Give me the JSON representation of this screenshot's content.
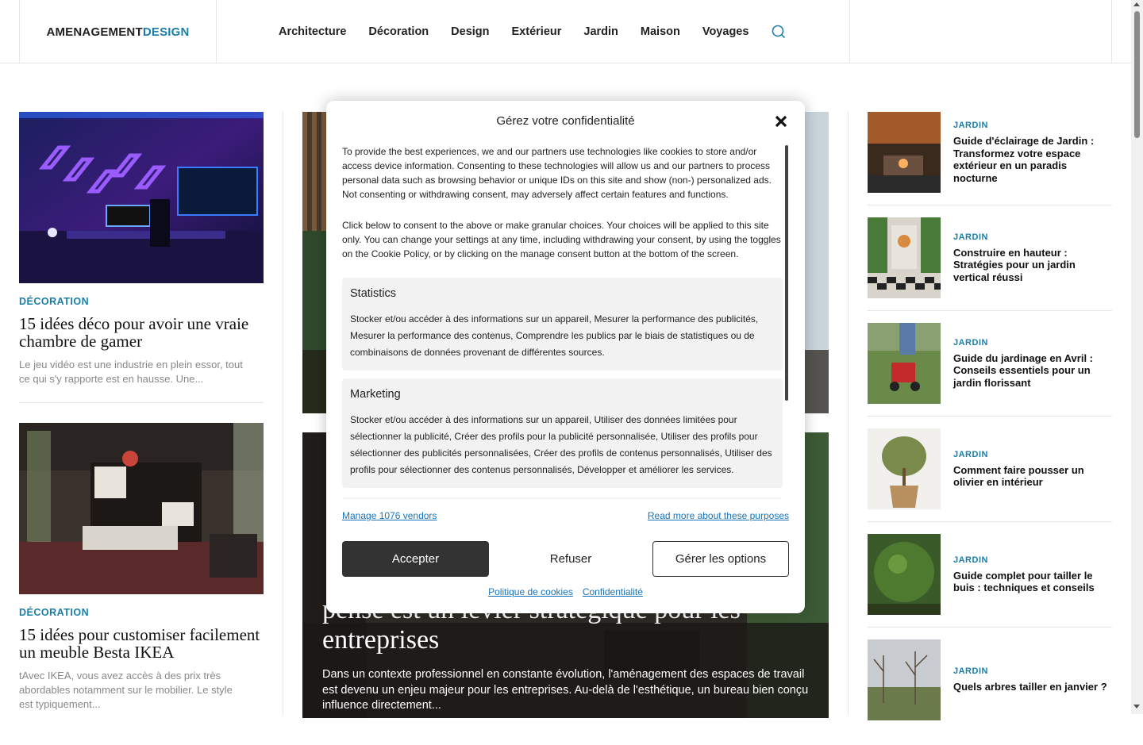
{
  "header": {
    "logo_part1": "AMENAGEMENT",
    "logo_part2": "DESIGN",
    "nav": [
      "Architecture",
      "Décoration",
      "Design",
      "Extérieur",
      "Jardin",
      "Maison",
      "Voyages"
    ]
  },
  "left_cards": [
    {
      "category": "DÉCORATION",
      "title": "15 idées déco pour avoir une vraie chambre de gamer",
      "excerpt": "Le jeu vidéo est une industrie en plein essor, tout ce qui s'y rapporte est en hausse. Une..."
    },
    {
      "category": "DÉCORATION",
      "title": "15 idées pour customiser facilement un meuble Besta IKEA",
      "excerpt": "tAvec IKEA, vous avez accès à des prix très abordables notamment sur le mobilier. Le style est typiquement..."
    }
  ],
  "featured2": {
    "title": "pensé est un levier stratégique pour les entreprises",
    "excerpt": "Dans un contexte professionnel en constante évolution, l'aménagement des espaces de travail est devenu un enjeu majeur pour les entreprises. Au-delà de l'esthétique, un bureau bien conçu influence directement..."
  },
  "right_items": [
    {
      "category": "JARDIN",
      "title": "Guide d'éclairage de Jardin : Transformez votre espace extérieur en un paradis nocturne"
    },
    {
      "category": "JARDIN",
      "title": "Construire en hauteur : Stratégies pour un jardin vertical réussi"
    },
    {
      "category": "JARDIN",
      "title": "Guide du jardinage en Avril : Conseils essentiels pour un jardin florissant"
    },
    {
      "category": "JARDIN",
      "title": "Comment faire pousser un olivier en intérieur"
    },
    {
      "category": "JARDIN",
      "title": "Guide complet pour tailler le buis : techniques et conseils"
    },
    {
      "category": "JARDIN",
      "title": "Quels arbres tailler en janvier ?"
    }
  ],
  "consent": {
    "title": "Gérez votre confidentialité",
    "para1": "To provide the best experiences, we and our partners use technologies like cookies to store and/or access device information. Consenting to these technologies will allow us and our partners to process personal data such as browsing behavior or unique IDs on this site and show (non-) personalized ads. Not consenting or withdrawing consent, may adversely affect certain features and functions.",
    "para2": "Click below to consent to the above or make granular choices. Your choices will be applied to this site only. You can change your settings at any time, including withdrawing your consent, by using the toggles on the Cookie Policy, or by clicking on the manage consent button at the bottom of the screen.",
    "purposes": [
      {
        "name": "Statistics",
        "desc": "Stocker et/ou accéder à des informations sur un appareil, Mesurer la performance des publicités, Mesurer la performance des contenus, Comprendre les publics par le biais de statistiques ou de combinaisons de données provenant de différentes sources."
      },
      {
        "name": "Marketing",
        "desc": "Stocker et/ou accéder à des informations sur un appareil, Utiliser des données limitées pour sélectionner la publicité, Créer des profils pour la publicité personnalisée, Utiliser des profils pour sélectionner des publicités personnalisées, Créer des profils de contenus personnalisés, Utiliser des profils pour sélectionner des contenus personnalisés, Développer et améliorer les services."
      }
    ],
    "manage_vendors": "Manage 1076 vendors",
    "read_more": "Read more about these purposes",
    "accept": "Accepter",
    "refuse": "Refuser",
    "options": "Gérer les options",
    "cookie_policy": "Politique de cookies",
    "privacy": "Confidentialité"
  },
  "colors": {
    "accent": "#1a7ea6",
    "link": "#1a73b8",
    "primary_button": "#333333"
  }
}
